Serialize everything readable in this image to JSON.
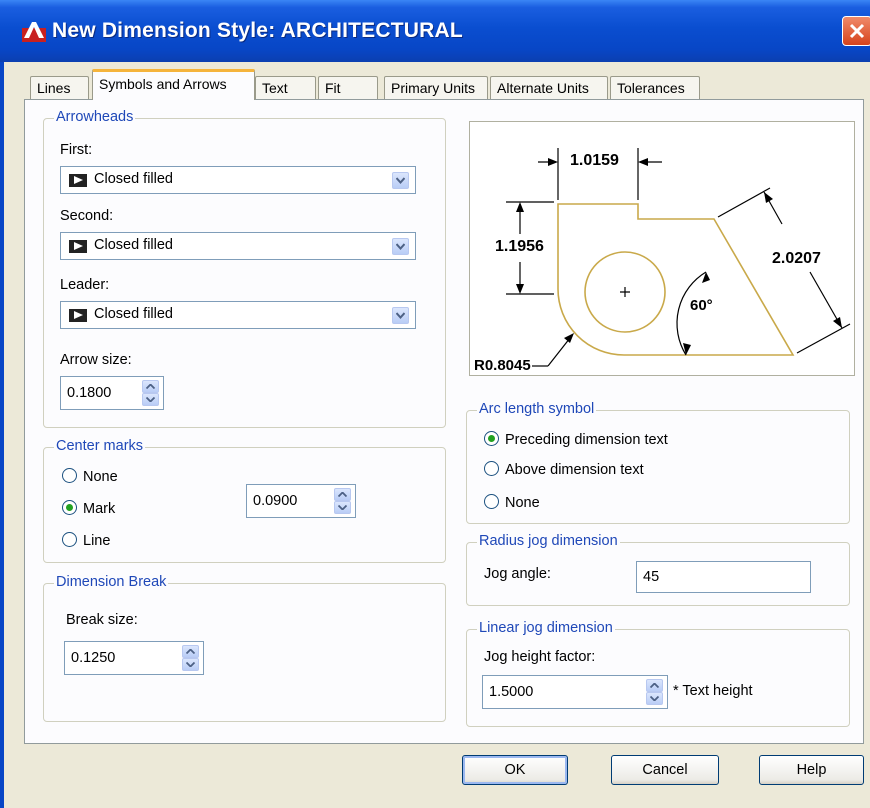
{
  "window": {
    "title": "New Dimension Style: ARCHITECTURAL"
  },
  "tabs": [
    {
      "label": "Lines"
    },
    {
      "label": "Symbols and Arrows"
    },
    {
      "label": "Text"
    },
    {
      "label": "Fit"
    },
    {
      "label": "Primary Units"
    },
    {
      "label": "Alternate Units"
    },
    {
      "label": "Tolerances"
    }
  ],
  "active_tab": "Symbols and Arrows",
  "arrowheads": {
    "legend": "Arrowheads",
    "first_label": "First:",
    "first_value": "Closed filled",
    "second_label": "Second:",
    "second_value": "Closed filled",
    "leader_label": "Leader:",
    "leader_value": "Closed filled",
    "arrow_size_label": "Arrow size:",
    "arrow_size_value": "0.1800"
  },
  "center_marks": {
    "legend": "Center marks",
    "options": [
      "None",
      "Mark",
      "Line"
    ],
    "selected": "Mark",
    "size_value": "0.0900"
  },
  "dimension_break": {
    "legend": "Dimension Break",
    "break_size_label": "Break size:",
    "break_size_value": "0.1250"
  },
  "preview": {
    "dim_top": "1.0159",
    "dim_left": "1.1956",
    "dim_right": "2.0207",
    "angle": "60°",
    "radius": "R0.8045"
  },
  "arc_length_symbol": {
    "legend": "Arc length symbol",
    "options": [
      "Preceding dimension text",
      "Above dimension text",
      "None"
    ],
    "selected": "Preceding dimension text"
  },
  "radius_jog": {
    "legend": "Radius jog dimension",
    "jog_angle_label": "Jog angle:",
    "jog_angle_value": "45"
  },
  "linear_jog": {
    "legend": "Linear jog dimension",
    "height_factor_label": "Jog height factor:",
    "height_factor_value": "1.5000",
    "suffix": "* Text height"
  },
  "buttons": {
    "ok": "OK",
    "cancel": "Cancel",
    "help": "Help"
  },
  "colors": {
    "title_bar": "#0a4ed0",
    "legend_text": "#1f48b8",
    "active_tab_accent": "#f5b43c",
    "radio_selected": "#21a121",
    "preview_outline": "#c9a94a"
  }
}
